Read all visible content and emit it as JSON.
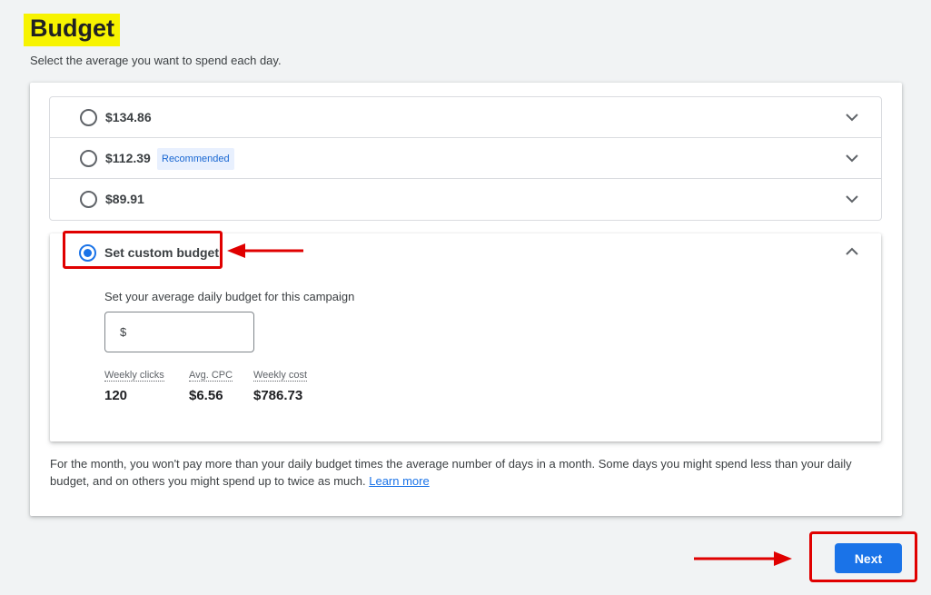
{
  "header": {
    "title": "Budget",
    "subtitle": "Select the average you want to spend each day."
  },
  "options": [
    {
      "label": "$134.86",
      "selected": false
    },
    {
      "label": "$112.39",
      "badge": "Recommended",
      "selected": false
    },
    {
      "label": "$89.91",
      "selected": false
    }
  ],
  "custom": {
    "label": "Set custom budget",
    "selected": true,
    "description": "Set your average daily budget for this campaign",
    "currency_symbol": "$",
    "input_value": "",
    "stats": [
      {
        "label": "Weekly clicks",
        "value": "120"
      },
      {
        "label": "Avg. CPC",
        "value": "$6.56"
      },
      {
        "label": "Weekly cost",
        "value": "$786.73"
      }
    ]
  },
  "note": {
    "text": "For the month, you won't pay more than your daily budget times the average number of days in a month. Some days you might spend less than your daily budget, and on others you might spend up to twice as much.",
    "link": "Learn more"
  },
  "actions": {
    "next_label": "Next"
  },
  "colors": {
    "accent": "#1a73e8",
    "highlight": "#f7f300",
    "annotation": "#e00000"
  },
  "icons": {
    "expand": "chevron-down-icon",
    "collapse": "chevron-up-icon",
    "annotation": "arrow-left-icon"
  }
}
